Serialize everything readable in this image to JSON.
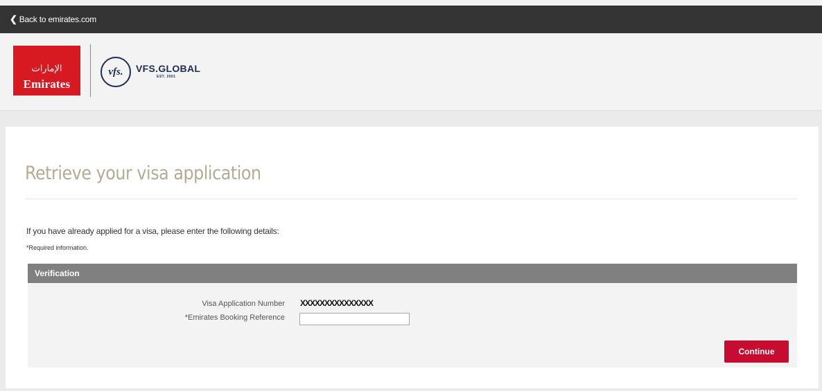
{
  "topbar": {
    "back_label": "Back to emirates.com"
  },
  "header": {
    "emirates_logo_text": "Emirates",
    "emirates_logo_glyph": "الإمارات",
    "vfs_monogram": "vfs.",
    "vfs_name": "VFS.GLOBAL",
    "vfs_est": "EST. 2001"
  },
  "main": {
    "title": "Retrieve your visa application",
    "intro": "If you have already applied for a visa, please enter the following details:",
    "required_note": "*Required information.",
    "panel": {
      "heading": "Verification",
      "visa_number_label": "Visa Application Number",
      "visa_number_value": "XXXXXXXXXXXXXXX",
      "booking_label": "*Emirates Booking Reference",
      "booking_value": "",
      "continue_label": "Continue"
    }
  },
  "colors": {
    "topbar": "#333333",
    "emirates_red": "#d71921",
    "vfs_navy": "#1d2c52",
    "title_gold": "#b5aa93",
    "panel_header": "#808080",
    "button": "#c60c30"
  }
}
